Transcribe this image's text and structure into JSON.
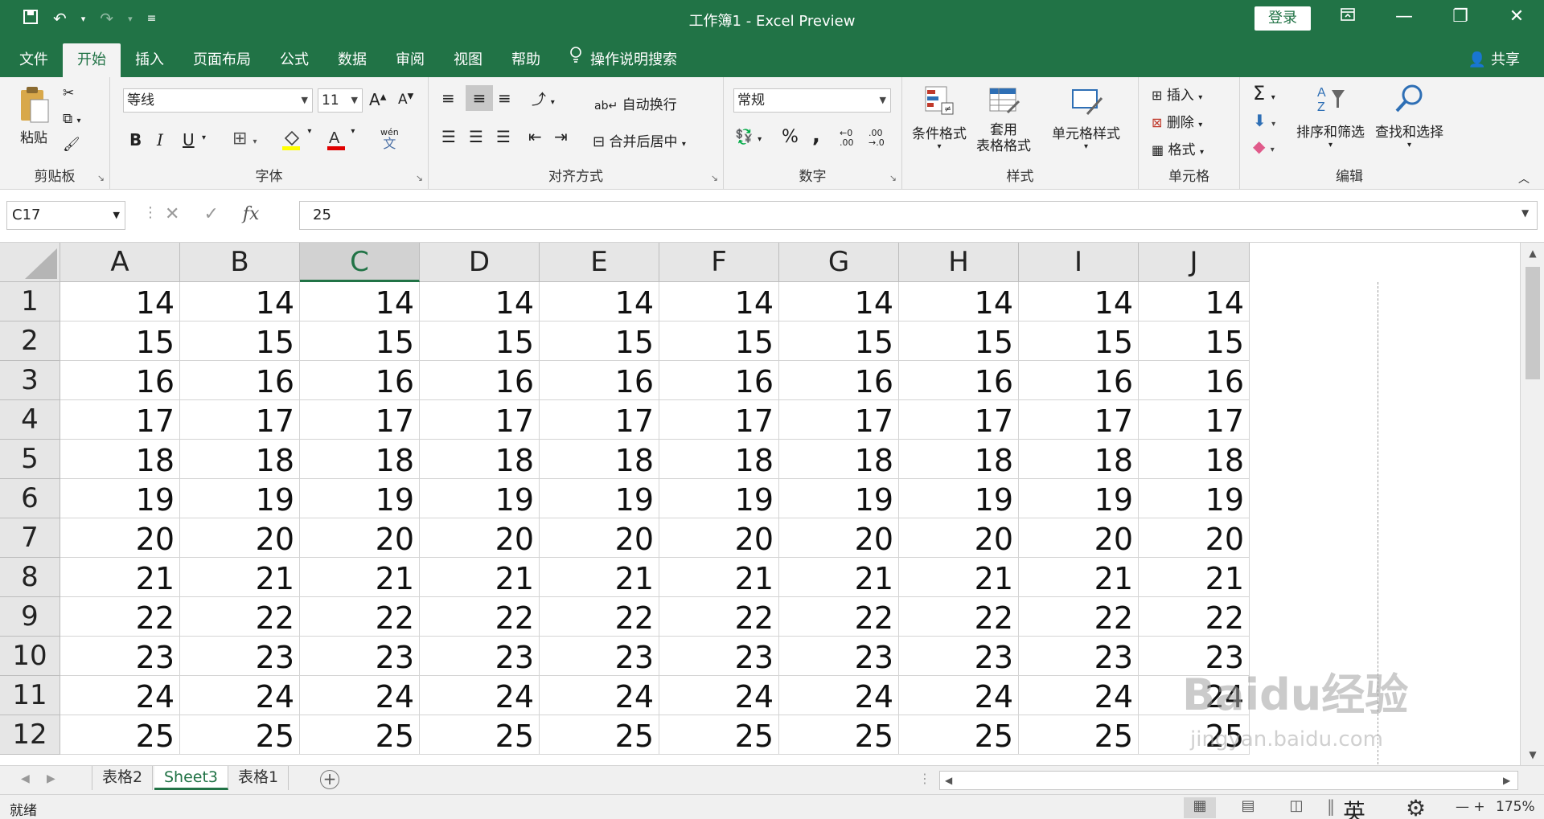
{
  "window": {
    "title": "工作簿1  -  Excel Preview",
    "login": "登录",
    "share": "共享"
  },
  "tabs": [
    {
      "label": "文件"
    },
    {
      "label": "开始"
    },
    {
      "label": "插入"
    },
    {
      "label": "页面布局"
    },
    {
      "label": "公式"
    },
    {
      "label": "数据"
    },
    {
      "label": "审阅"
    },
    {
      "label": "视图"
    },
    {
      "label": "帮助"
    }
  ],
  "tell_me": "操作说明搜索",
  "ribbon": {
    "clipboard": {
      "paste": "粘贴",
      "label": "剪贴板"
    },
    "font": {
      "name": "等线",
      "size": "11",
      "label": "字体",
      "bold": "B",
      "italic": "I",
      "underline": "U",
      "phonetic_top": "wén",
      "phonetic_bottom": "文"
    },
    "alignment": {
      "wrap": "自动换行",
      "merge": "合并后居中",
      "label": "对齐方式"
    },
    "number": {
      "format": "常规",
      "percent": "%",
      "comma": ",",
      "label": "数字"
    },
    "styles": {
      "conditional": "条件格式",
      "table_top": "套用",
      "table_bottom": "表格格式",
      "cell_styles": "单元格样式",
      "label": "样式"
    },
    "cells": {
      "insert": "插入",
      "delete": "删除",
      "format": "格式",
      "label": "单元格"
    },
    "editing": {
      "sort": "排序和筛选",
      "find": "查找和选择",
      "label": "编辑"
    }
  },
  "formula_bar": {
    "name_box": "C17",
    "value": "25"
  },
  "sheet": {
    "columns": [
      "A",
      "B",
      "C",
      "D",
      "E",
      "F",
      "G",
      "H",
      "I",
      "J"
    ],
    "selected_column": "C",
    "rows": [
      {
        "n": "1",
        "values": [
          "14",
          "14",
          "14",
          "14",
          "14",
          "14",
          "14",
          "14",
          "14",
          "14"
        ]
      },
      {
        "n": "2",
        "values": [
          "15",
          "15",
          "15",
          "15",
          "15",
          "15",
          "15",
          "15",
          "15",
          "15"
        ]
      },
      {
        "n": "3",
        "values": [
          "16",
          "16",
          "16",
          "16",
          "16",
          "16",
          "16",
          "16",
          "16",
          "16"
        ]
      },
      {
        "n": "4",
        "values": [
          "17",
          "17",
          "17",
          "17",
          "17",
          "17",
          "17",
          "17",
          "17",
          "17"
        ]
      },
      {
        "n": "5",
        "values": [
          "18",
          "18",
          "18",
          "18",
          "18",
          "18",
          "18",
          "18",
          "18",
          "18"
        ]
      },
      {
        "n": "6",
        "values": [
          "19",
          "19",
          "19",
          "19",
          "19",
          "19",
          "19",
          "19",
          "19",
          "19"
        ]
      },
      {
        "n": "7",
        "values": [
          "20",
          "20",
          "20",
          "20",
          "20",
          "20",
          "20",
          "20",
          "20",
          "20"
        ]
      },
      {
        "n": "8",
        "values": [
          "21",
          "21",
          "21",
          "21",
          "21",
          "21",
          "21",
          "21",
          "21",
          "21"
        ]
      },
      {
        "n": "9",
        "values": [
          "22",
          "22",
          "22",
          "22",
          "22",
          "22",
          "22",
          "22",
          "22",
          "22"
        ]
      },
      {
        "n": "10",
        "values": [
          "23",
          "23",
          "23",
          "23",
          "23",
          "23",
          "23",
          "23",
          "23",
          "23"
        ]
      },
      {
        "n": "11",
        "values": [
          "24",
          "24",
          "24",
          "24",
          "24",
          "24",
          "24",
          "24",
          "24",
          "24"
        ]
      },
      {
        "n": "12",
        "values": [
          "25",
          "25",
          "25",
          "25",
          "25",
          "25",
          "25",
          "25",
          "25",
          "25"
        ]
      }
    ]
  },
  "sheet_tabs": [
    {
      "label": "表格2"
    },
    {
      "label": "Sheet3"
    },
    {
      "label": "表格1"
    }
  ],
  "active_sheet": "Sheet3",
  "status": {
    "ready": "就绪",
    "ime": "英",
    "zoom": "175%"
  },
  "watermark": {
    "main": "Baidu经验",
    "sub": "jingyan.baidu.com"
  },
  "colors": {
    "accent": "#217346",
    "ribbon_bg": "#f3f3f3",
    "header_bg": "#e6e6e6"
  }
}
